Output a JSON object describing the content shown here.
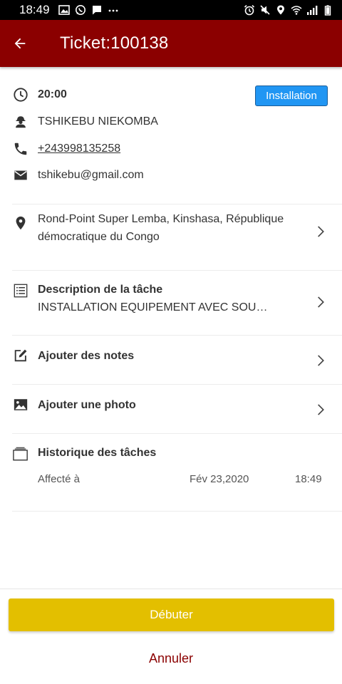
{
  "status_bar": {
    "time": "18:49",
    "left_icons": [
      "image-icon",
      "whatsapp-icon",
      "message-icon",
      "more-dots-icon"
    ],
    "right_icons": [
      "alarm-icon",
      "mute-icon",
      "location-icon",
      "wifi-icon",
      "signal-icon",
      "battery-icon"
    ]
  },
  "app_bar": {
    "title": "Ticket:100138",
    "back_icon": "arrow-back-icon",
    "background": "#8b0000"
  },
  "ticket": {
    "time": "20:00",
    "category": "Installation",
    "customer_name": "TSHIKEBU NIEKOMBA",
    "phone": "+243998135258",
    "email": "tshikebu@gmail.com",
    "address": "Rond-Point Super Lemba, Kinshasa, République démocratique du Congo"
  },
  "task": {
    "title": "Description de la tâche",
    "description": "INSTALLATION EQUIPEMENT AVEC SOU…"
  },
  "actions": {
    "add_notes": "Ajouter des notes",
    "add_photo": "Ajouter une photo"
  },
  "history": {
    "title": "Historique des tâches",
    "entries": [
      {
        "status": "Affecté à",
        "date": "Fév 23,2020",
        "time": "18:49"
      }
    ]
  },
  "buttons": {
    "start": "Débuter",
    "cancel": "Annuler"
  },
  "colors": {
    "primary": "#8b0000",
    "badge": "#2196f3",
    "start_button": "#e3bf00"
  }
}
